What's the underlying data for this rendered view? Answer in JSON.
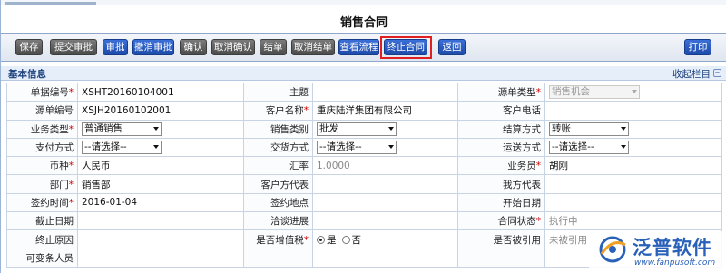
{
  "page": {
    "title": "销售合同"
  },
  "toolbar": {
    "buttons": [
      "保存",
      "提交审批",
      "审批",
      "撤消审批",
      "确认",
      "取消确认",
      "结单",
      "取消结单",
      "查看流程",
      "终止合同",
      "返回"
    ],
    "print_label": "打印"
  },
  "section": {
    "title": "基本信息",
    "collapse_label": "收起栏目",
    "collapse_icon": "collapse-icon"
  },
  "form": {
    "rows": [
      {
        "l1": "单据编号",
        "r1": true,
        "v1": "XSHT20160104001",
        "l2": "主题",
        "r2": false,
        "v2": "",
        "l3": "源单类型",
        "r3": true,
        "v3": "销售机会"
      },
      {
        "l1": "源单编号",
        "r1": false,
        "v1": "XSJH20160102001",
        "l2": "客户名称",
        "r2": true,
        "v2": "重庆陆洋集团有限公司",
        "l3": "客户电话",
        "r3": false,
        "v3": ""
      },
      {
        "l1": "业务类型",
        "r1": true,
        "v1": "普通销售",
        "l2": "销售类别",
        "r2": false,
        "v2": "批发",
        "l3": "结算方式",
        "r3": false,
        "v3": "转账"
      },
      {
        "l1": "支付方式",
        "r1": false,
        "v1": "--请选择--",
        "l2": "交货方式",
        "r2": false,
        "v2": "--请选择--",
        "l3": "运送方式",
        "r3": false,
        "v3": "--请选择--"
      },
      {
        "l1": "币种",
        "r1": true,
        "v1": "人民币",
        "l2": "汇率",
        "r2": false,
        "v2": "1.0000",
        "l3": "业务员",
        "r3": true,
        "v3": "胡刚"
      },
      {
        "l1": "部门",
        "r1": true,
        "v1": "销售部",
        "l2": "客户方代表",
        "r2": false,
        "v2": "",
        "l3": "我方代表",
        "r3": false,
        "v3": ""
      },
      {
        "l1": "签约时间",
        "r1": true,
        "v1": "2016-01-04",
        "l2": "签约地点",
        "r2": false,
        "v2": "",
        "l3": "开始日期",
        "r3": false,
        "v3": ""
      },
      {
        "l1": "截止日期",
        "r1": false,
        "v1": "",
        "l2": "洽谈进展",
        "r2": false,
        "v2": "",
        "l3": "合同状态",
        "r3": true,
        "v3": "执行中"
      },
      {
        "l1": "终止原因",
        "r1": false,
        "v1": "",
        "l2": "是否增值税",
        "r2": true,
        "v2": "",
        "l3": "是否被引用",
        "r3": false,
        "v3": "未被引用"
      },
      {
        "l1": "可变条人员",
        "r1": false,
        "v1": "",
        "l2": "",
        "r2": false,
        "v2": "",
        "l3": "",
        "r3": false,
        "v3": ""
      }
    ],
    "vat_options": [
      "是",
      "否"
    ],
    "vat_selected": "是"
  },
  "watermark": {
    "name": "泛普软件",
    "url": "www.fanpusoft.com"
  },
  "colors": {
    "accent": "#2a61b8",
    "required": "#d00000",
    "highlight": "#e02020"
  }
}
